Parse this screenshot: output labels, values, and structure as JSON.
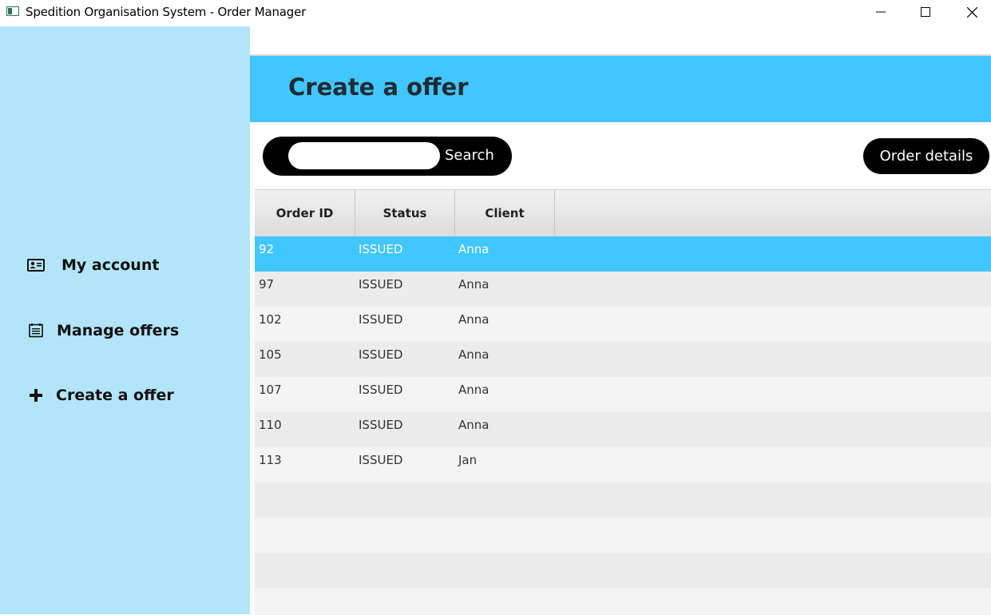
{
  "window": {
    "title": "Spedition Organisation System - Order Manager"
  },
  "sidebar": {
    "items": [
      {
        "label": "My account",
        "icon": "id-card-icon"
      },
      {
        "label": "Manage offers",
        "icon": "list-icon"
      },
      {
        "label": "Create a offer",
        "icon": "plus-icon"
      }
    ]
  },
  "header": {
    "title": "Create a offer",
    "color": "#42c6fe"
  },
  "search": {
    "placeholder": "",
    "value": "",
    "button_label": "Search"
  },
  "toolbar": {
    "order_details_label": "Order details"
  },
  "table": {
    "columns": [
      "Order ID",
      "Status",
      "Client"
    ],
    "rows": [
      {
        "id": "92",
        "status": "ISSUED",
        "client": "Anna",
        "selected": true
      },
      {
        "id": "97",
        "status": "ISSUED",
        "client": "Anna"
      },
      {
        "id": "102",
        "status": "ISSUED",
        "client": "Anna"
      },
      {
        "id": "105",
        "status": "ISSUED",
        "client": "Anna"
      },
      {
        "id": "107",
        "status": "ISSUED",
        "client": "Anna"
      },
      {
        "id": "110",
        "status": "ISSUED",
        "client": "Anna"
      },
      {
        "id": "113",
        "status": "ISSUED",
        "client": "Jan"
      }
    ],
    "selected_color": "#42c6fe"
  }
}
